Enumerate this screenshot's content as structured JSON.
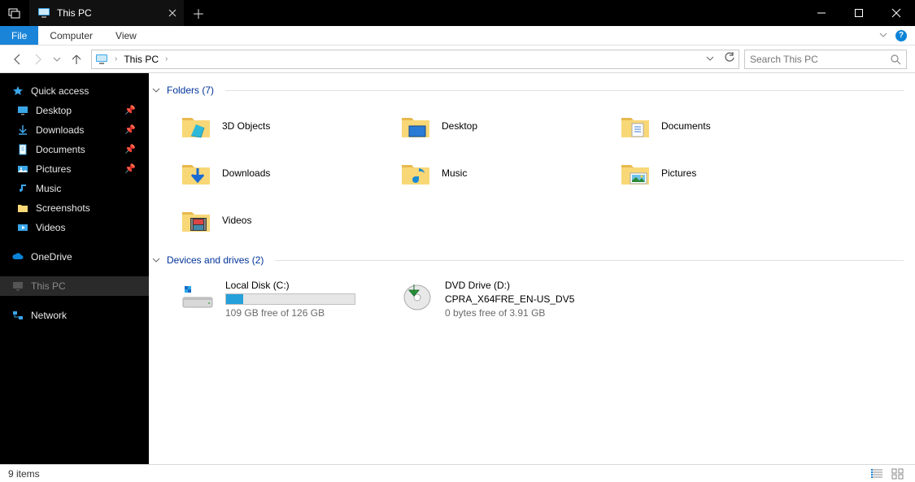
{
  "titlebar": {
    "tab_title": "This PC"
  },
  "ribbon": {
    "file": "File",
    "computer": "Computer",
    "view": "View"
  },
  "address": {
    "crumb1": "This PC",
    "search_placeholder": "Search This PC"
  },
  "sidebar": {
    "quick_access": "Quick access",
    "desktop": "Desktop",
    "downloads": "Downloads",
    "documents": "Documents",
    "pictures": "Pictures",
    "music": "Music",
    "screenshots": "Screenshots",
    "videos": "Videos",
    "onedrive": "OneDrive",
    "this_pc": "This PC",
    "network": "Network"
  },
  "sections": {
    "folders_title": "Folders (7)",
    "drives_title": "Devices and drives (2)"
  },
  "folders": {
    "f0": "3D Objects",
    "f1": "Desktop",
    "f2": "Documents",
    "f3": "Downloads",
    "f4": "Music",
    "f5": "Pictures",
    "f6": "Videos"
  },
  "drives": {
    "d0": {
      "name": "Local Disk (C:)",
      "free": "109 GB free of 126 GB",
      "fill_pct": 13
    },
    "d1": {
      "name": "DVD Drive (D:)",
      "label": "CPRA_X64FRE_EN-US_DV5",
      "free": "0 bytes free of 3.91 GB"
    }
  },
  "status": {
    "items": "9 items"
  }
}
